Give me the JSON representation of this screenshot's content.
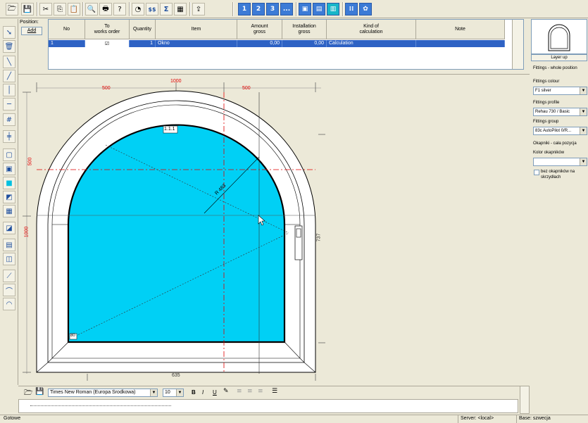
{
  "toolbar": {
    "icons": [
      "open-folder-icon",
      "save-icon",
      "cut-icon",
      "copy-icon",
      "paste-icon",
      "preview-icon",
      "print-icon",
      "help-icon",
      "calculate-icon",
      "prices-icon",
      "sum-icon",
      "table-icon",
      "export-icon"
    ],
    "view_buttons": [
      "1",
      "2",
      "3"
    ],
    "view_more": "...",
    "glyphs": {
      "open": "🗁",
      "save": "💾",
      "cut": "✂",
      "copy": "⎘",
      "paste": "📋",
      "preview": "🔍",
      "print": "🖶",
      "help": "?",
      "calc": "◔",
      "prices": "$$",
      "sum": "Σ",
      "table": "▦",
      "export": "⇪",
      "frame1": "▣",
      "frame2": "▤",
      "frame3": "▥",
      "grid": "⁞⁞",
      "bug": "✿"
    }
  },
  "positions": {
    "title": "Position:",
    "add_label": "Add",
    "columns": [
      "No",
      "To\nworks order",
      "Quantity",
      "Item",
      "Amount\ngross",
      "Installation\ngross",
      "Kind of\ncalculation",
      "Note"
    ],
    "row": {
      "no": "1",
      "to_works_order": "☑",
      "quantity": "1",
      "item": "Okno",
      "amount_gross": "0,00",
      "installation_gross": "0,00",
      "kind": "Calculation",
      "note": ""
    }
  },
  "drawing": {
    "dim_top_total": "1000",
    "dim_top_left": "500",
    "dim_top_right": "500",
    "dim_left_total": "1000",
    "dim_left_arch": "500",
    "dim_right": "737",
    "dim_bottom": "635",
    "sash_label": "1.1.1",
    "radius_label": "R 483",
    "corner_label": "80"
  },
  "right_panel": {
    "layer_up": "Layer up",
    "fittings_title": "Fittings - whole position",
    "fittings_colour_label": "Fittings colour",
    "fittings_colour_value": "F1 silver",
    "fittings_profile_label": "Fittings profile",
    "fittings_profile_value": "Rehau 730 / Basic",
    "fittings_group_label": "Fittings group",
    "fittings_group_value": "83c    AutoPilot 0/R...",
    "okapniki_title": "Okapniki - cała pozycja",
    "kolor_label": "Kolor okapników",
    "kolor_value": "",
    "checkbox_label": "bez okapników na skrzydłach"
  },
  "format_bar": {
    "font_name": "Times New Roman (Europa Środkowa)",
    "font_size": "10",
    "bold": "B",
    "italic": "I",
    "underline": "U"
  },
  "status": {
    "left": "Gotowe",
    "server": "Server:  <local>",
    "base": "Base:  szwecja"
  },
  "colors": {
    "glass": "#00d0f5",
    "accent": "#2e62c4",
    "dim_red": "#e00000"
  }
}
